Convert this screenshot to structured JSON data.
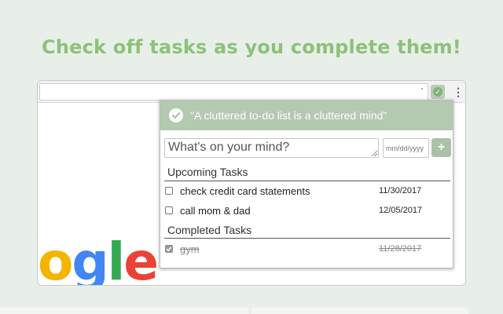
{
  "headline": "Check off tasks as you complete them!",
  "logo": {
    "letters": [
      "o",
      "g",
      "l",
      "e"
    ],
    "colors": [
      "#f4b400",
      "#4285f4",
      "#34a853",
      "#ea4335"
    ]
  },
  "popup": {
    "quote": "\"A cluttered to-do list is a cluttered mind\"",
    "input_placeholder": "What's on your mind?",
    "date_placeholder": "mm/dd/yyyy",
    "add_label": "+",
    "upcoming_title": "Upcoming Tasks",
    "completed_title": "Completed Tasks",
    "upcoming": [
      {
        "name": "check credit card statements",
        "date": "11/30/2017",
        "checked": false
      },
      {
        "name": "call mom & dad",
        "date": "12/05/2017",
        "checked": false
      }
    ],
    "completed": [
      {
        "name": "gym",
        "date": "11/28/2017",
        "checked": true
      }
    ]
  },
  "colors": {
    "accent": "#8dc17b",
    "header_bg": "#b3c9b0",
    "background": "#e8efe8"
  }
}
